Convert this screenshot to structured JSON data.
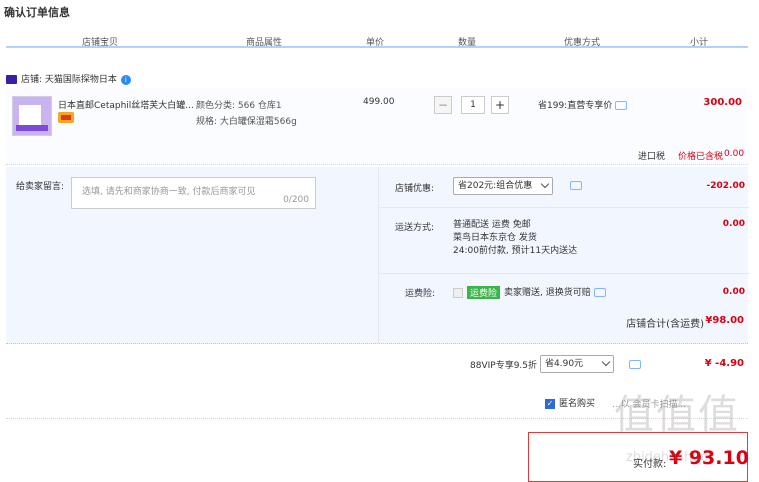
{
  "page_title": "确认订单信息",
  "columns": [
    "店铺宝贝",
    "商品属性",
    "单价",
    "数量",
    "优惠方式",
    "小计"
  ],
  "shop": {
    "name": "店铺: 天猫国际探物日本",
    "info_badge": "i"
  },
  "item": {
    "name": "日本直邮Cetaphil丝塔芙大白罐...",
    "attr_color": "颜色分类: 566 仓库1",
    "attr_spec": "规格: 大白罐保湿霜566g",
    "unit_price": "499.00",
    "quantity": "1",
    "promo": "省199:直营专享价",
    "subtotal": "300.00",
    "tax_label": "进口税",
    "tax_note": "价格已含税",
    "tax_value": "0.00"
  },
  "message": {
    "label": "给卖家留言:",
    "placeholder": "选填, 请先和商家协商一致, 付款后商家可见",
    "counter": "0/200"
  },
  "store_discount": {
    "label": "店铺优惠:",
    "selected": "省202元:组合优惠",
    "value": "-202.00"
  },
  "shipping": {
    "label": "运送方式:",
    "line1": "普通配送 运费 免邮",
    "line2": "菜鸟日本东京仓  发货",
    "line3": "24:00前付款, 预计11天内送达",
    "value": "0.00"
  },
  "insurance": {
    "label": "运费险:",
    "badge": "运费险",
    "text": "卖家赠送, 退换货可赔",
    "value": "0.00"
  },
  "store_total": {
    "label": "店铺合计(含运费)",
    "value": "¥98.00"
  },
  "vip": {
    "label": "88VIP专享9.5折",
    "selected": "省4.90元",
    "value": "¥ -4.90"
  },
  "anonymous": {
    "label": "匿名购买",
    "note": "...以  会员卡扫描..."
  },
  "payment": {
    "label": "实付款:",
    "value": "¥ 93.10"
  },
  "watermark": {
    "big": "值值值",
    "small": "zhidehnshuo"
  },
  "colors": {
    "price_red": "#d9000f",
    "link_blue": "#2a6bd8",
    "panel_bg": "#f2f7ff"
  }
}
